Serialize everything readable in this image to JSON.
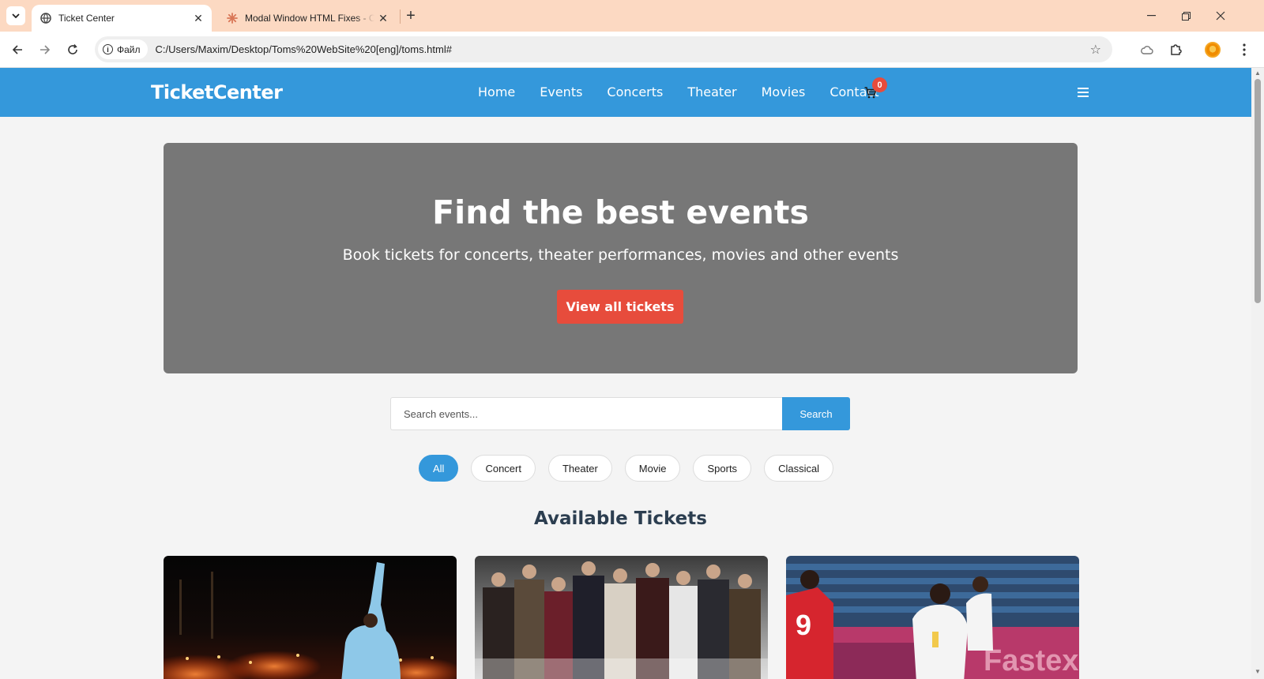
{
  "browser": {
    "tabs": [
      {
        "title": "Ticket Center",
        "active": true,
        "icon": "globe-icon"
      },
      {
        "title": "Modal Window HTML Fixes - Cl",
        "active": false,
        "icon": "claude-asterisk-icon"
      }
    ],
    "site_chip": "Файл",
    "url": "C:/Users/Maxim/Desktop/Toms%20WebSite%20[eng]/toms.html#",
    "accent": "#fcd9c2"
  },
  "site": {
    "logo": "TicketCenter",
    "nav": [
      "Home",
      "Events",
      "Concerts",
      "Theater",
      "Movies",
      "Contact"
    ],
    "cart_count": "0",
    "brand_color": "#3498db",
    "accent_color": "#e74c3c"
  },
  "hero": {
    "title": "Find the best events",
    "subtitle": "Book tickets for concerts, theater performances, movies and other events",
    "button": "View all tickets"
  },
  "search": {
    "placeholder": "Search events...",
    "button": "Search"
  },
  "filters": [
    {
      "label": "All",
      "active": true
    },
    {
      "label": "Concert",
      "active": false
    },
    {
      "label": "Theater",
      "active": false
    },
    {
      "label": "Movie",
      "active": false
    },
    {
      "label": "Sports",
      "active": false
    },
    {
      "label": "Classical",
      "active": false
    }
  ],
  "section": {
    "title": "Available Tickets"
  },
  "cards": [
    {
      "image": "concert-performer-image"
    },
    {
      "image": "theater-cast-image"
    },
    {
      "image": "football-match-image"
    }
  ]
}
